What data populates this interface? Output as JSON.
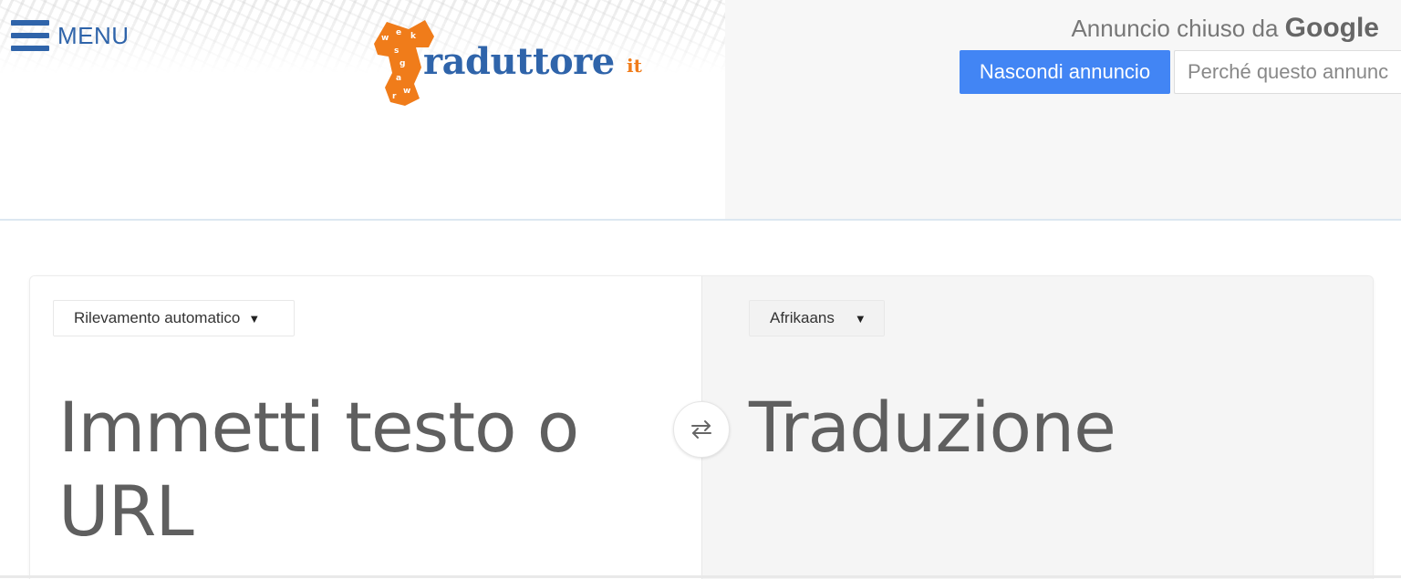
{
  "header": {
    "menu_label": "MENU",
    "logo": {
      "text": "raduttore",
      "suffix": "it",
      "accent": "#f07c1a",
      "brand": "#2f64aa"
    }
  },
  "ad": {
    "closed_by_prefix": "Annuncio chiuso da",
    "closed_by_brand": "Google",
    "hide_button": "Nascondi annuncio",
    "why_button": "Perché questo annunc"
  },
  "translator": {
    "source_language": "Rilevamento automatico",
    "target_language": "Afrikaans",
    "source_placeholder": "Immetti testo o URL",
    "target_placeholder": "Traduzione",
    "swap_icon": "swap-arrows-icon"
  },
  "colors": {
    "primary_button": "#4285f4",
    "text_gray": "#5f5f5f"
  }
}
